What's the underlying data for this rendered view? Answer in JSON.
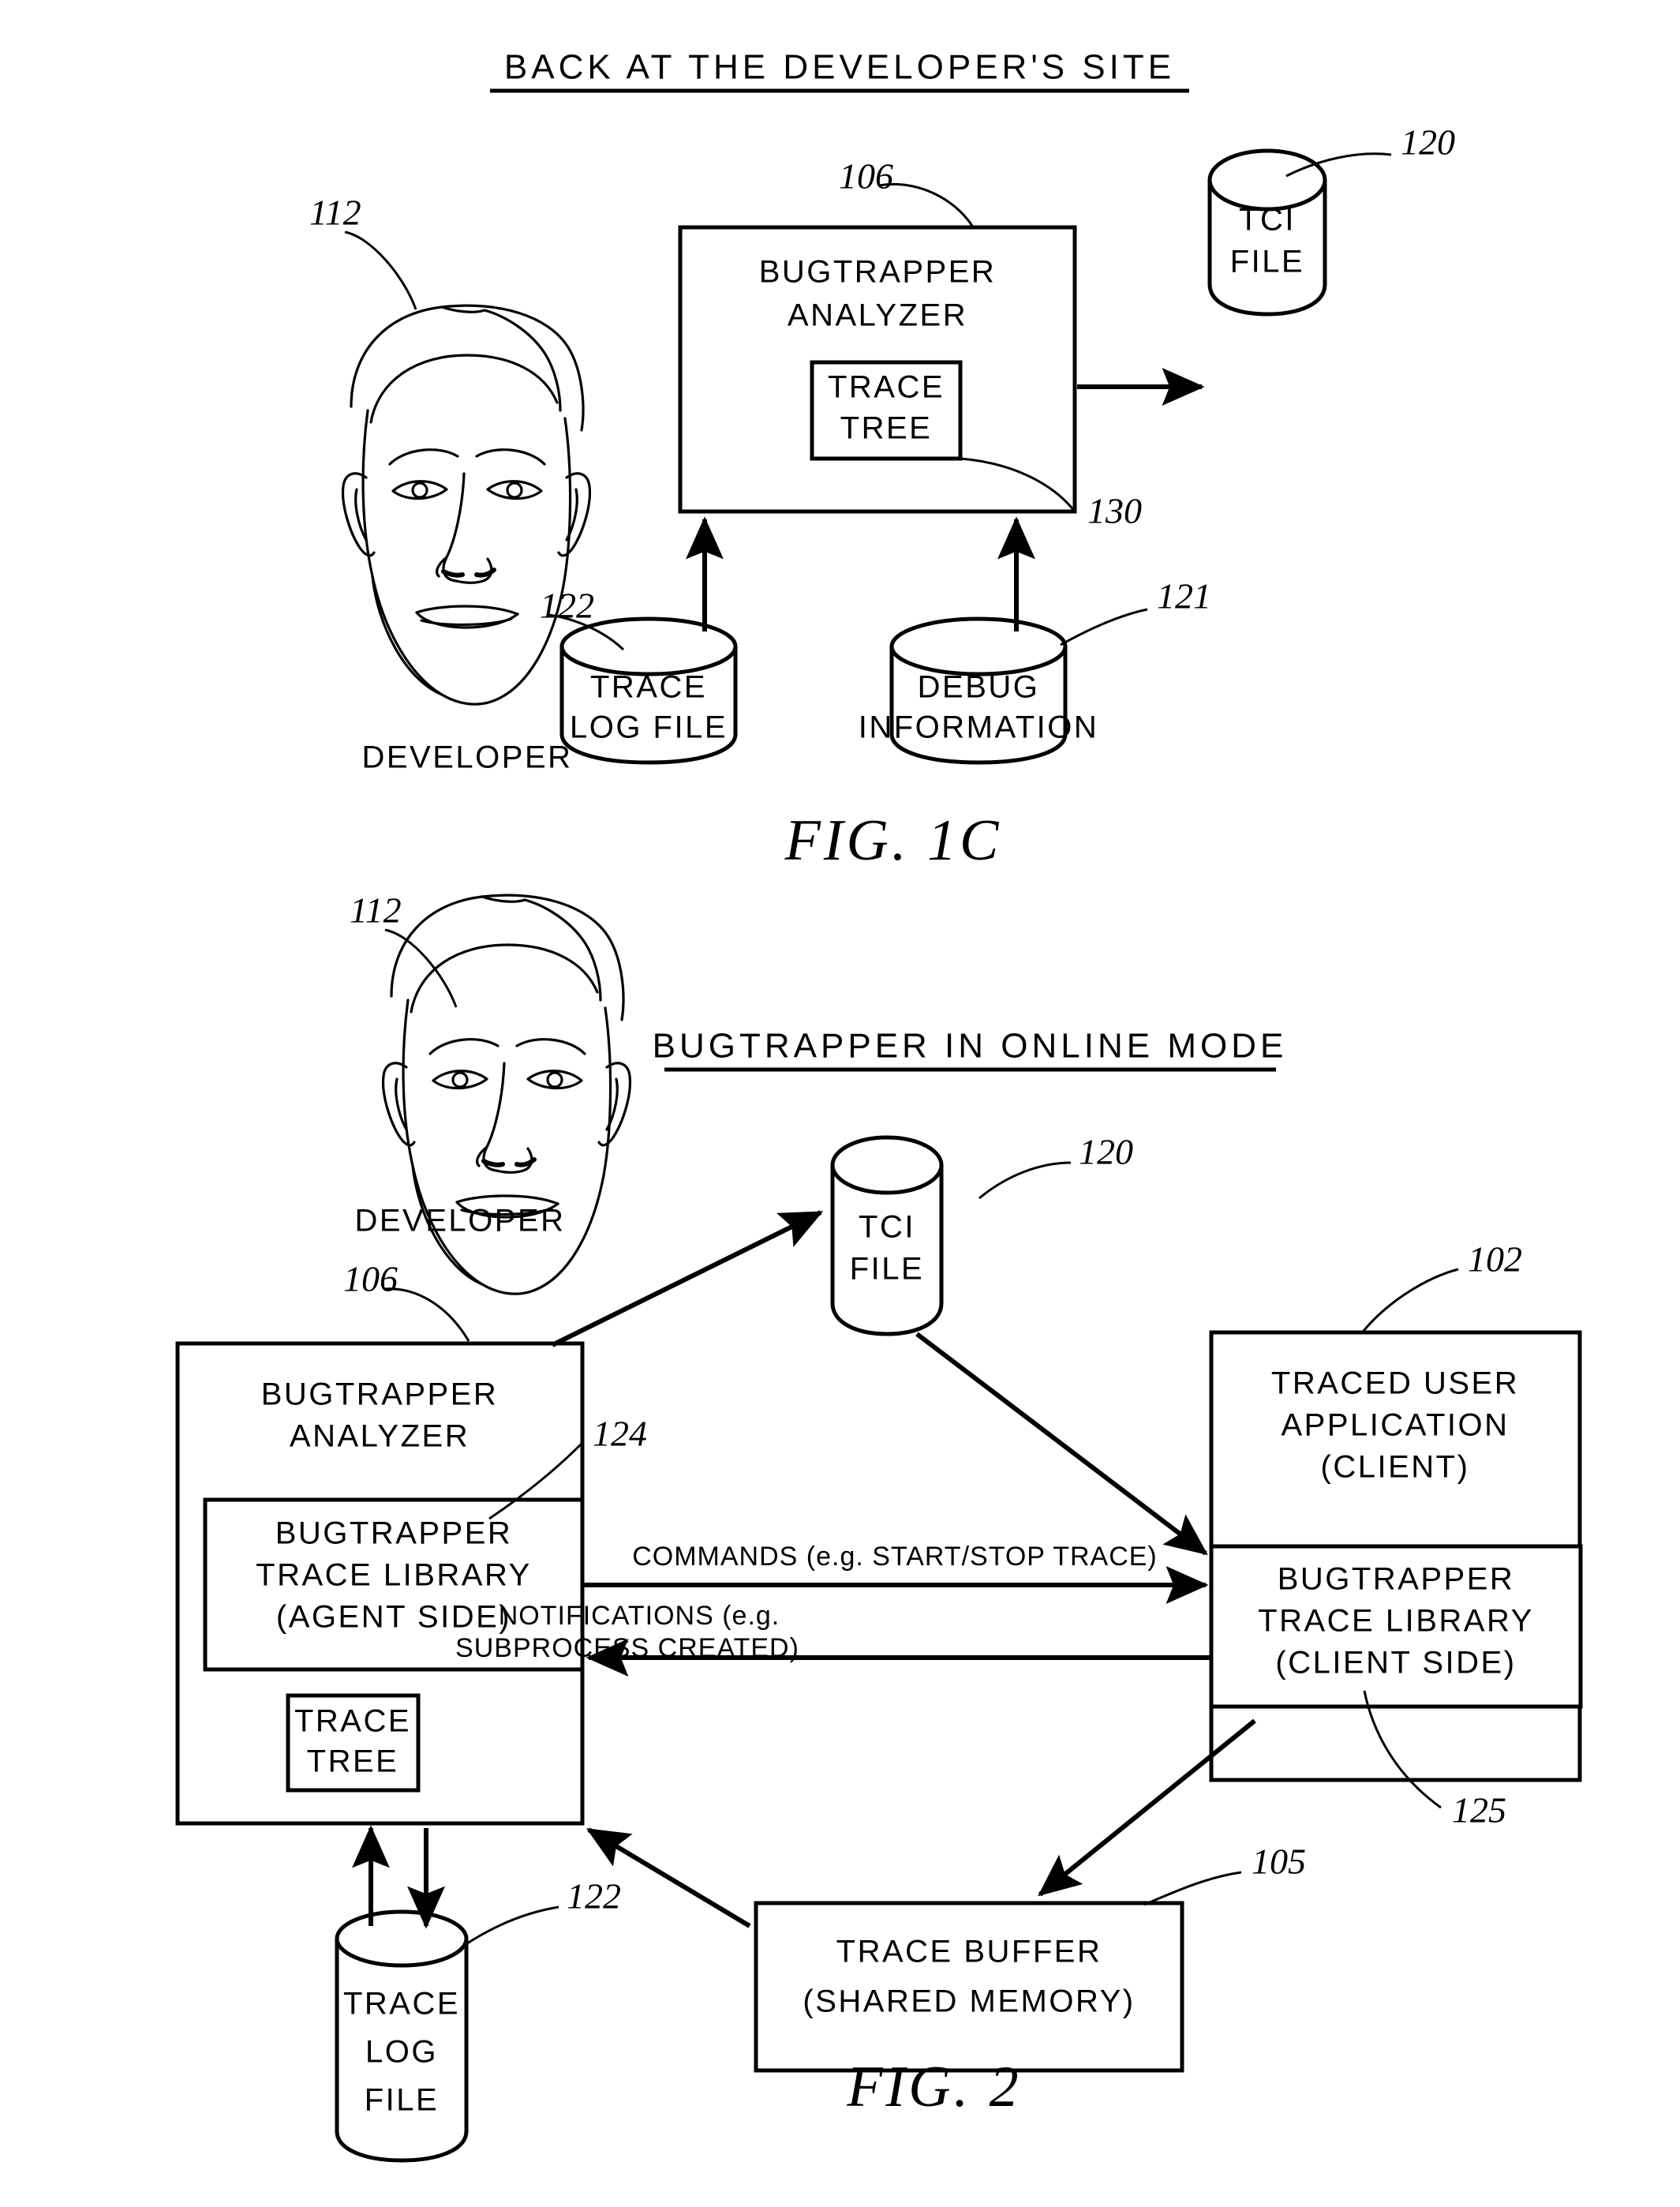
{
  "figures": [
    {
      "id": "fig-1c",
      "heading": "BACK AT THE DEVELOPER'S SITE",
      "caption": "FIG. 1C",
      "actor": {
        "label": "DEVELOPER",
        "ref": "112"
      },
      "nodes": [
        {
          "id": "analyzer",
          "label_lines": [
            "BUGTRAPPER",
            "ANALYZER"
          ],
          "ref": "106",
          "shape": "rect"
        },
        {
          "id": "trace-tree",
          "label_lines": [
            "TRACE",
            "TREE"
          ],
          "ref": "130",
          "shape": "rect"
        },
        {
          "id": "tci-file",
          "label_lines": [
            "TCI",
            "FILE"
          ],
          "ref": "120",
          "shape": "cylinder"
        },
        {
          "id": "trace-log-file",
          "label_lines": [
            "TRACE",
            "LOG FILE"
          ],
          "ref": "122",
          "shape": "cylinder"
        },
        {
          "id": "debug-information",
          "label_lines": [
            "DEBUG",
            "INFORMATION"
          ],
          "ref": "121",
          "shape": "cylinder"
        }
      ],
      "connections": [
        {
          "from": "analyzer",
          "to": "tci-file",
          "label": ""
        },
        {
          "from": "trace-log-file",
          "to": "analyzer",
          "label": ""
        },
        {
          "from": "debug-information",
          "to": "analyzer",
          "label": ""
        }
      ]
    },
    {
      "id": "fig-2",
      "heading": "BUGTRAPPER IN ONLINE MODE",
      "caption": "FIG. 2",
      "actor": {
        "label": "DEVELOPER",
        "ref": "112"
      },
      "nodes": [
        {
          "id": "analyzer",
          "label_lines": [
            "BUGTRAPPER",
            "ANALYZER"
          ],
          "ref": "106",
          "shape": "rect"
        },
        {
          "id": "agent-trace-library",
          "label_lines": [
            "BUGTRAPPER",
            "TRACE LIBRARY",
            "(AGENT SIDE)"
          ],
          "ref": "124",
          "shape": "rect"
        },
        {
          "id": "trace-tree",
          "label_lines": [
            "TRACE",
            "TREE"
          ],
          "ref": "",
          "shape": "rect"
        },
        {
          "id": "tci-file",
          "label_lines": [
            "TCI",
            "FILE"
          ],
          "ref": "120",
          "shape": "cylinder"
        },
        {
          "id": "traced-user-application",
          "label_lines": [
            "TRACED USER",
            "APPLICATION",
            "(CLIENT)"
          ],
          "ref": "102",
          "shape": "rect"
        },
        {
          "id": "client-trace-library",
          "label_lines": [
            "BUGTRAPPER",
            "TRACE LIBRARY",
            "(CLIENT SIDE)"
          ],
          "ref": "125",
          "shape": "rect"
        },
        {
          "id": "trace-buffer",
          "label_lines": [
            "TRACE BUFFER",
            "(SHARED MEMORY)"
          ],
          "ref": "105",
          "shape": "rect"
        },
        {
          "id": "trace-log-file",
          "label_lines": [
            "TRACE",
            "LOG",
            "FILE"
          ],
          "ref": "122",
          "shape": "cylinder"
        }
      ],
      "connections": [
        {
          "from": "analyzer",
          "to": "tci-file",
          "label": ""
        },
        {
          "from": "tci-file",
          "to": "client-trace-library",
          "label": ""
        },
        {
          "from": "agent-trace-library",
          "to": "client-trace-library",
          "label": "COMMANDS (e.g. START/STOP TRACE)"
        },
        {
          "from": "client-trace-library",
          "to": "agent-trace-library",
          "label_lines": [
            "NOTIFICATIONS (e.g.",
            "SUBPROCESS CREATED)"
          ]
        },
        {
          "from": "client-trace-library",
          "to": "trace-buffer",
          "label": ""
        },
        {
          "from": "trace-buffer",
          "to": "analyzer",
          "label": ""
        },
        {
          "from": "analyzer",
          "to": "trace-log-file",
          "label": ""
        },
        {
          "from": "trace-log-file",
          "to": "analyzer",
          "label": ""
        }
      ],
      "arrow_labels": {
        "commands": "COMMANDS (e.g. START/STOP TRACE)",
        "notifications_line1": "NOTIFICATIONS (e.g.",
        "notifications_line2": "SUBPROCESS CREATED)"
      }
    }
  ],
  "text": {
    "fig1c_heading": "BACK AT THE DEVELOPER'S SITE",
    "fig1c_caption": "FIG. 1C",
    "fig2_heading": "BUGTRAPPER IN ONLINE MODE",
    "fig2_caption": "FIG. 2",
    "developer": "DEVELOPER",
    "bugtrapper": "BUGTRAPPER",
    "analyzer": "ANALYZER",
    "trace": "TRACE",
    "tree": "TREE",
    "tci": "TCI",
    "file": "FILE",
    "log_file": "LOG FILE",
    "log": "LOG",
    "debug": "DEBUG",
    "information": "INFORMATION",
    "trace_library": "TRACE LIBRARY",
    "agent_side": "(AGENT SIDE)",
    "client_side": "(CLIENT SIDE)",
    "traced_user": "TRACED USER",
    "application": "APPLICATION",
    "client": "(CLIENT)",
    "trace_buffer": "TRACE BUFFER",
    "shared_memory": "(SHARED MEMORY)",
    "commands": "COMMANDS (e.g. START/STOP TRACE)",
    "notifications_1": "NOTIFICATIONS (e.g.",
    "notifications_2": "SUBPROCESS CREATED)"
  },
  "refs": {
    "r112a": "112",
    "r106a": "106",
    "r120a": "120",
    "r130": "130",
    "r122a": "122",
    "r121": "121",
    "r112b": "112",
    "r106b": "106",
    "r120b": "120",
    "r102": "102",
    "r124": "124",
    "r125": "125",
    "r105": "105",
    "r122b": "122"
  },
  "colors": {
    "ink": "#000000",
    "paper": "#ffffff"
  }
}
